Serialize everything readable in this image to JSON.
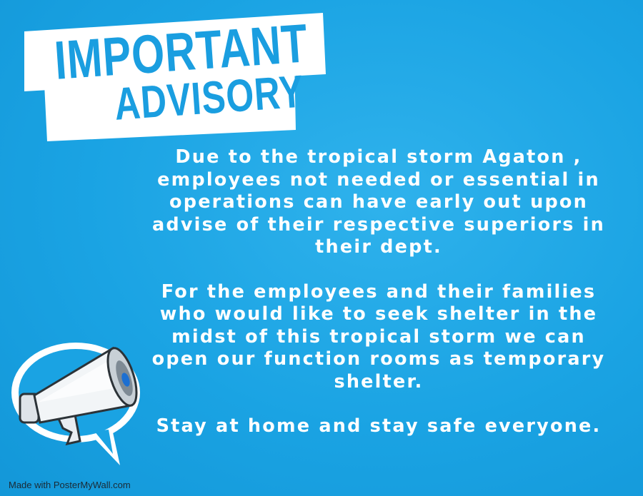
{
  "banner": {
    "title_line1": "IMPORTANT",
    "title_line2": "ADVISORY"
  },
  "advisory": {
    "paragraph1": "Due to the tropical storm Agaton , employees not needed or essential in operations can have early out upon advise of their respective superiors in their dept.",
    "paragraph2": "For the employees and their families who would like to seek shelter in the midst of this tropical storm we can open our function rooms as temporary shelter.",
    "paragraph3": "Stay at home and stay safe everyone."
  },
  "icons": {
    "megaphone": "megaphone-icon"
  },
  "watermark": "Made with PosterMyWall.com",
  "colors": {
    "background": "#1aa3e3",
    "title_text": "#1a9ee0",
    "banner": "#ffffff",
    "body_text": "#ffffff"
  }
}
